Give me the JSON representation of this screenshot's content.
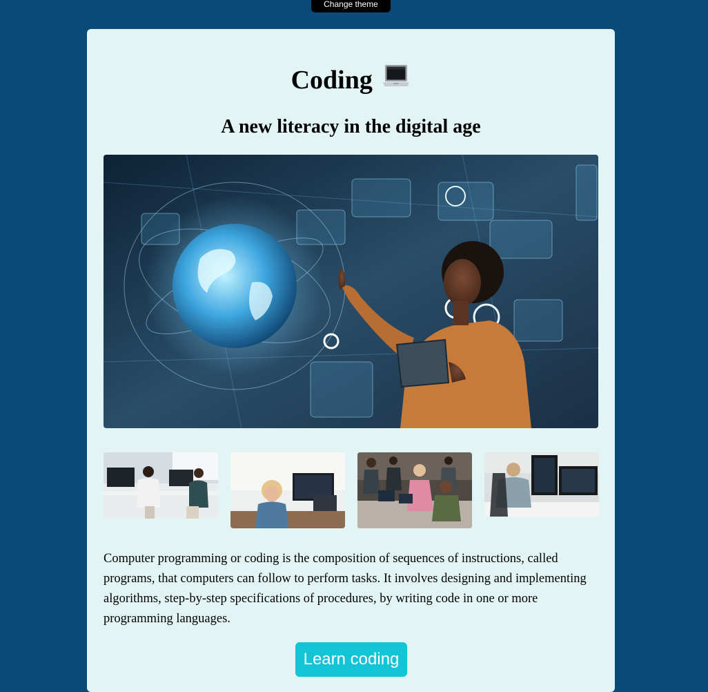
{
  "header": {
    "theme_button_label": "Change theme"
  },
  "hero": {
    "title": "Coding",
    "title_icon": "laptop-icon",
    "subtitle": "A new literacy in the digital age"
  },
  "images": {
    "main": "woman-holographic-earth-photo",
    "thumbnails": [
      "office-team-photo",
      "smiling-coder-photo",
      "group-workspace-photo",
      "developer-monitors-photo"
    ]
  },
  "content": {
    "description": "Computer programming or coding is the composition of sequences of instructions, called programs, that computers can follow to perform tasks. It involves designing and implementing algorithms, step-by-step specifications of procedures, by writing code in one or more programming languages."
  },
  "cta": {
    "label": "Learn coding"
  },
  "colors": {
    "page_bg": "#0a4a78",
    "card_bg": "#e2f5f4",
    "cta_bg": "#13c3d6",
    "theme_button_bg": "#000000"
  }
}
